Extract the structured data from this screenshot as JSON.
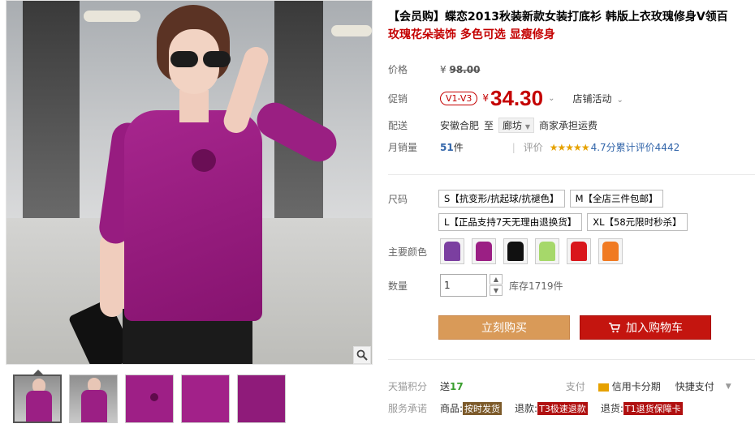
{
  "product": {
    "title": "【会员购】蝶恋2013秋装新款女装打底衫 韩版上衣玫瑰修身V领百",
    "subtitle": "玫瑰花朵装饰 多色可选 显瘦修身"
  },
  "price": {
    "label": "价格",
    "currency": "¥",
    "original": "98.00"
  },
  "promo": {
    "label": "促销",
    "badge": "V1-V3",
    "currency": "¥",
    "value": "34.30",
    "store_activity": "店铺活动"
  },
  "delivery": {
    "label": "配送",
    "from": "安徽合肥",
    "to_word": "至",
    "region": "廊坊",
    "shipping": "商家承担运费"
  },
  "monthly_sales": {
    "label": "月销量",
    "count": "51",
    "unit": "件",
    "rating_label": "评价",
    "stars": "★★★★★",
    "score": "4.7分",
    "total_reviews": "累计评价4442"
  },
  "size": {
    "label": "尺码",
    "options": [
      "S【抗变形/抗起球/抗褪色】",
      "M【全店三件包邮】",
      "L【正品支持7天无理由退换货】",
      "XL【58元限时秒杀】"
    ]
  },
  "colors": {
    "label": "主要颜色",
    "swatches": [
      {
        "name": "紫色",
        "hex": "#7b3fa0"
      },
      {
        "name": "玫红",
        "hex": "#9b1f84"
      },
      {
        "name": "黑色",
        "hex": "#111111"
      },
      {
        "name": "绿色",
        "hex": "#a6d86a"
      },
      {
        "name": "红色",
        "hex": "#d9161b"
      },
      {
        "name": "橙色",
        "hex": "#f07a22"
      }
    ]
  },
  "quantity": {
    "label": "数量",
    "value": "1",
    "stock": "库存1719件"
  },
  "buttons": {
    "buy_now": "立刻购买",
    "add_to_cart": "加入购物车"
  },
  "tmall_points": {
    "label": "天猫积分",
    "give": "送",
    "points": "17",
    "pay_label": "支付",
    "credit_card": "信用卡分期",
    "quick_pay": "快捷支付"
  },
  "service": {
    "label": "服务承诺",
    "goods": "商品:",
    "goods_tag": "按时发货",
    "refund": "退款:",
    "refund_tag": "T3极速退款",
    "return": "退货:",
    "return_tag": "T1退货保障卡"
  }
}
